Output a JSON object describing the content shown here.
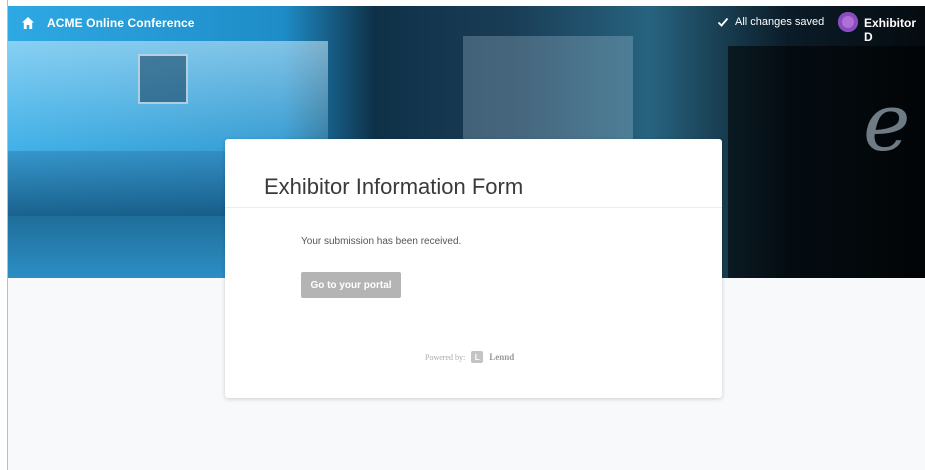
{
  "header": {
    "app_title": "ACME Online Conference",
    "home_icon": "home-icon",
    "save_status": "All changes saved",
    "save_icon": "checkmark-icon",
    "user_name": "Exhibitor D"
  },
  "form": {
    "title": "Exhibitor Information Form",
    "confirmation_message": "Your submission has been received.",
    "portal_button_label": "Go to your portal"
  },
  "footer": {
    "powered_by_label": "Powered by:",
    "brand_logo_letter": "L",
    "brand_name": "Lennd"
  },
  "colors": {
    "hero_accent": "#2ea9e4",
    "button_bg": "#b4b4b4",
    "avatar": "#b06fd6",
    "page_bg": "#f8f9fb"
  }
}
